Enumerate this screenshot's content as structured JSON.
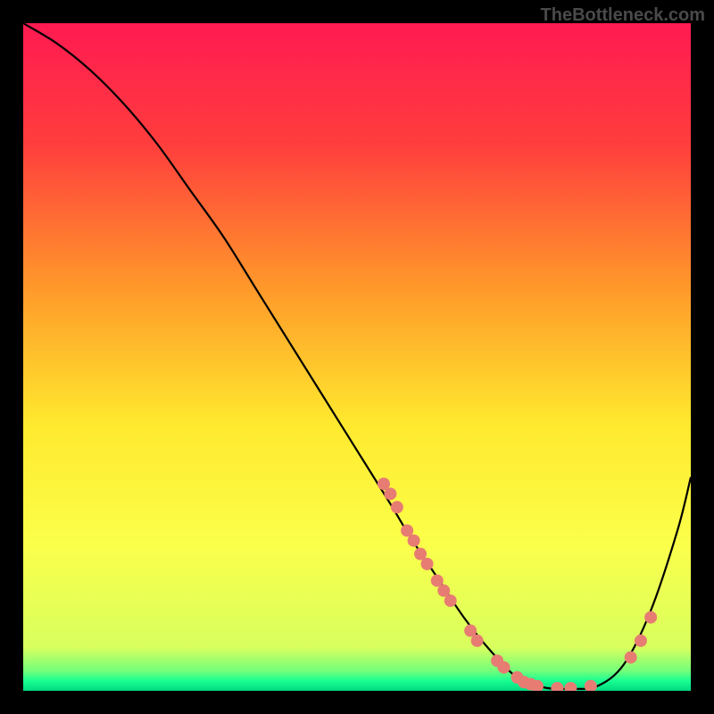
{
  "watermark": "TheBottleneck.com",
  "chart_data": {
    "type": "line",
    "title": "",
    "xlabel": "",
    "ylabel": "",
    "xlim": [
      0,
      100
    ],
    "ylim": [
      0,
      100
    ],
    "gradient": {
      "stops": [
        {
          "offset": 0.0,
          "color": "#ff1a52"
        },
        {
          "offset": 0.18,
          "color": "#ff3d3d"
        },
        {
          "offset": 0.4,
          "color": "#ff9a2a"
        },
        {
          "offset": 0.6,
          "color": "#ffe92e"
        },
        {
          "offset": 0.78,
          "color": "#fbff4a"
        },
        {
          "offset": 0.935,
          "color": "#d8ff5e"
        },
        {
          "offset": 0.97,
          "color": "#74ff7a"
        },
        {
          "offset": 0.985,
          "color": "#19ff93"
        },
        {
          "offset": 1.0,
          "color": "#00d97f"
        }
      ]
    },
    "series": [
      {
        "name": "bottleneck-curve",
        "x": [
          0,
          5,
          10,
          15,
          20,
          25,
          30,
          35,
          40,
          45,
          50,
          55,
          58,
          62,
          66,
          70,
          74,
          78,
          82,
          86,
          90,
          94,
          98,
          100
        ],
        "y": [
          100,
          97,
          93,
          88,
          82,
          75,
          68,
          60,
          52,
          44,
          36,
          28,
          23,
          17,
          11,
          6,
          2,
          0.5,
          0.3,
          0.7,
          4,
          12,
          24,
          32
        ]
      }
    ],
    "scatter": {
      "name": "data-points",
      "color": "#e77c73",
      "r": 7,
      "points": [
        {
          "x": 54,
          "y": 31
        },
        {
          "x": 55,
          "y": 29.5
        },
        {
          "x": 56,
          "y": 27.5
        },
        {
          "x": 57.5,
          "y": 24
        },
        {
          "x": 58.5,
          "y": 22.5
        },
        {
          "x": 59.5,
          "y": 20.5
        },
        {
          "x": 60.5,
          "y": 19
        },
        {
          "x": 62,
          "y": 16.5
        },
        {
          "x": 63,
          "y": 15
        },
        {
          "x": 64,
          "y": 13.5
        },
        {
          "x": 67,
          "y": 9
        },
        {
          "x": 68,
          "y": 7.5
        },
        {
          "x": 71,
          "y": 4.5
        },
        {
          "x": 72,
          "y": 3.5
        },
        {
          "x": 74,
          "y": 2
        },
        {
          "x": 75,
          "y": 1.3
        },
        {
          "x": 76,
          "y": 1
        },
        {
          "x": 77,
          "y": 0.7
        },
        {
          "x": 80,
          "y": 0.4
        },
        {
          "x": 82,
          "y": 0.4
        },
        {
          "x": 85,
          "y": 0.7
        },
        {
          "x": 91,
          "y": 5
        },
        {
          "x": 92.5,
          "y": 7.5
        },
        {
          "x": 94,
          "y": 11
        }
      ]
    }
  }
}
